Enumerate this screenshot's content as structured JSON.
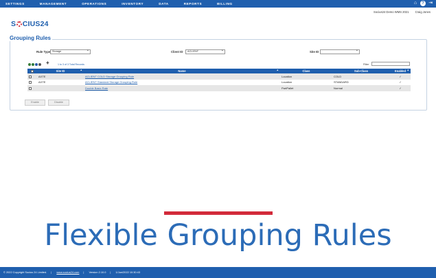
{
  "nav": {
    "items": [
      "SETTINGS",
      "MANAGEMENT",
      "OPERATIONS",
      "INVENTORY",
      "DATA",
      "REPORTS",
      "BILLING"
    ],
    "icons": [
      "home-icon",
      "help-icon",
      "logout-icon"
    ]
  },
  "userbar": {
    "app": "Socius24 Demo WMS 2021",
    "user": "Craig Jones"
  },
  "logo": {
    "pre": "S",
    "post": "CIUS24"
  },
  "section": {
    "title": "Grouping Rules"
  },
  "filters": {
    "rule_type_label": "Rule Type",
    "rule_type_value": "Storage",
    "client_label": "Client ID",
    "client_value": "ACLIENT",
    "site_label": "Site ID",
    "site_value": ""
  },
  "list": {
    "records": "1 to 3 of 3 Total Records",
    "filter_label": "Filter"
  },
  "table": {
    "columns": [
      "Site ID",
      "Name",
      "Class",
      "Sub-Class",
      "Enabled"
    ],
    "rows": [
      {
        "site": "AXTE",
        "name": "ACLIENT COLD Storage Grouping Rule",
        "class": "Location",
        "subclass": "COLD",
        "enabled": "✓"
      },
      {
        "site": "AXTE",
        "name": "ACLIENT Standard Storage Grouping Rule",
        "class": "Location",
        "subclass": "STANDARD",
        "enabled": "✓"
      },
      {
        "site": "",
        "name": "Double Basic Rate",
        "class": "PartPallet",
        "subclass": "Normal",
        "enabled": "✓"
      }
    ]
  },
  "buttons": {
    "enable": "Enable",
    "disable": "Disable"
  },
  "headline": "Flexible Grouping Rules",
  "footer": {
    "copyright": "© 2022 Copyright Socius 24 Limited.",
    "link": "www.socius24.com",
    "version": "Version 2.10.0",
    "timestamp": "1/Jun/2022 10:30:43"
  },
  "colors": {
    "brand": "#1f5fae",
    "accent": "#d22a3a"
  }
}
